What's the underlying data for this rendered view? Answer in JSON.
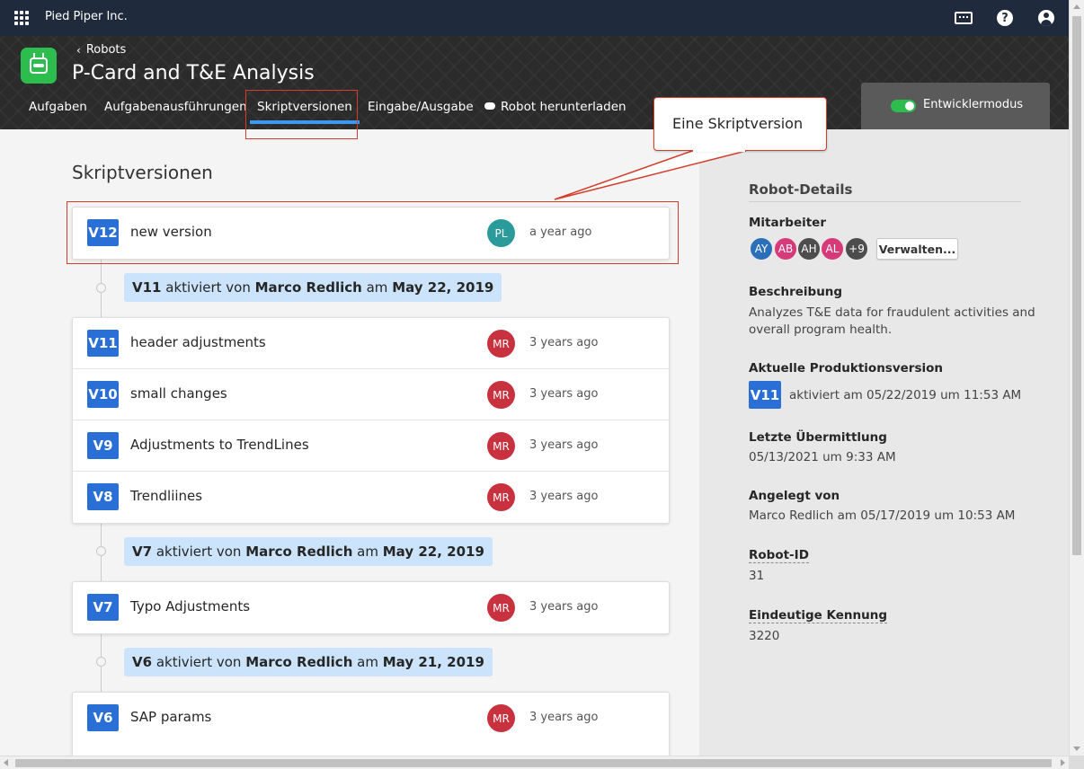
{
  "topbar": {
    "org_name": "Pied Piper Inc.",
    "icons": [
      "apps-grid-icon",
      "keyboard-icon",
      "help-icon",
      "user-account-icon"
    ]
  },
  "header": {
    "back_label": "Robots",
    "title": "P-Card and T&E Analysis",
    "tabs": [
      {
        "label": "Aufgaben",
        "active": false
      },
      {
        "label": "Aufgabenausführungen",
        "active": false
      },
      {
        "label": "Skriptversionen",
        "active": true
      },
      {
        "label": "Eingabe/Ausgabe",
        "active": false
      },
      {
        "label": "Robot herunterladen",
        "active": false,
        "icon": "cloud-download-icon"
      }
    ],
    "dev_mode_label": "Entwicklermodus",
    "dev_mode_on": true
  },
  "callout": {
    "text": "Eine Skriptversion"
  },
  "main": {
    "title": "Skriptversionen",
    "v12": {
      "version": "V12",
      "name": "new version",
      "avatar": "PL",
      "time": "a year ago"
    },
    "activations": [
      {
        "version": "V11",
        "by_text": "aktiviert von",
        "author": "Marco Redlich",
        "on_text": "am",
        "date": "May 22, 2019"
      },
      {
        "version": "V7",
        "by_text": "aktiviert von",
        "author": "Marco Redlich",
        "on_text": "am",
        "date": "May 22, 2019"
      },
      {
        "version": "V6",
        "by_text": "aktiviert von",
        "author": "Marco Redlich",
        "on_text": "am",
        "date": "May 21, 2019"
      }
    ],
    "group_v11": [
      {
        "version": "V11",
        "name": "header adjustments",
        "avatar": "MR",
        "time": "3 years ago"
      },
      {
        "version": "V10",
        "name": "small changes",
        "avatar": "MR",
        "time": "3 years ago"
      },
      {
        "version": "V9",
        "name": "Adjustments to TrendLines",
        "avatar": "MR",
        "time": "3 years ago"
      },
      {
        "version": "V8",
        "name": "Trendliines",
        "avatar": "MR",
        "time": "3 years ago"
      }
    ],
    "group_v7": [
      {
        "version": "V7",
        "name": "Typo Adjustments",
        "avatar": "MR",
        "time": "3 years ago"
      }
    ],
    "group_v6": [
      {
        "version": "V6",
        "name": "SAP params",
        "avatar": "MR",
        "time": "3 years ago"
      }
    ]
  },
  "sidebar": {
    "heading": "Robot-Details",
    "collaborators_label": "Mitarbeiter",
    "collaborators": [
      "AY",
      "AB",
      "AH",
      "AL",
      "+9"
    ],
    "manage_label": "Verwalten...",
    "description_label": "Beschreibung",
    "description_line1": "Analyzes T&E data for fraudulent activities and",
    "description_line2": "overall program health.",
    "prod_label": "Aktuelle Produktionsversion",
    "prod_version": "V11",
    "prod_text": "aktiviert am 05/22/2019 um 11:53 AM",
    "last_submit_label": "Letzte Übermittlung",
    "last_submit_value": "05/13/2021 um 9:33 AM",
    "created_label": "Angelegt von",
    "created_value": "Marco Redlich am 05/17/2019 um 10:53 AM",
    "robot_id_label": "Robot-ID",
    "robot_id_value": "31",
    "unique_id_label": "Eindeutige Kennung",
    "unique_id_value": "3220"
  },
  "colors": {
    "accent": "#2a6fd6",
    "avatar_mr": "#c8323f",
    "avatar_pl": "#2a9a9a",
    "highlight": "#d43d2a",
    "pill": "#cce4fb"
  }
}
